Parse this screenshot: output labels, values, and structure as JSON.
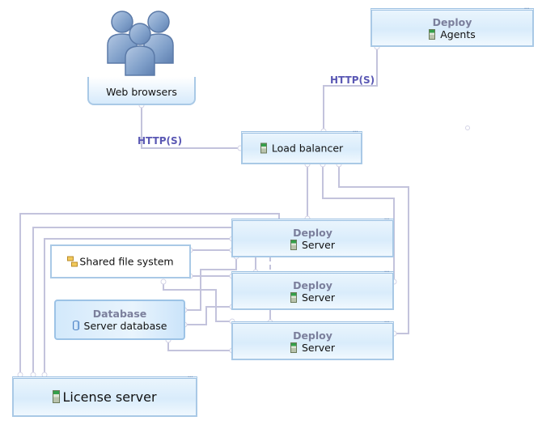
{
  "diagram": {
    "web_browsers": {
      "label": "Web browsers",
      "icon": "users-icon"
    },
    "agents": {
      "stereotype": "Deploy",
      "label": "Agents",
      "icon": "server-icon"
    },
    "load_balancer": {
      "label": "Load balancer",
      "icon": "server-icon"
    },
    "servers": [
      {
        "stereotype": "Deploy",
        "label": "Server",
        "icon": "server-icon"
      },
      {
        "stereotype": "Deploy",
        "label": "Server",
        "icon": "server-icon"
      },
      {
        "stereotype": "Deploy",
        "label": "Server",
        "icon": "server-icon"
      }
    ],
    "shared_fs": {
      "label": "Shared file system",
      "icon": "file-system-icon"
    },
    "database": {
      "stereotype": "Database",
      "label": "Server database",
      "icon": "database-icon"
    },
    "license_server": {
      "label": "License server",
      "icon": "server-icon"
    },
    "connections": {
      "browser_to_lb": "HTTP(S)",
      "agents_to_lb": "HTTP(S)"
    },
    "colors": {
      "wire": "#c3c3dc",
      "node_border": "#a9c9e6",
      "stereotype_text": "#7b7f9c",
      "protocol_label": "#5a58b4"
    }
  }
}
